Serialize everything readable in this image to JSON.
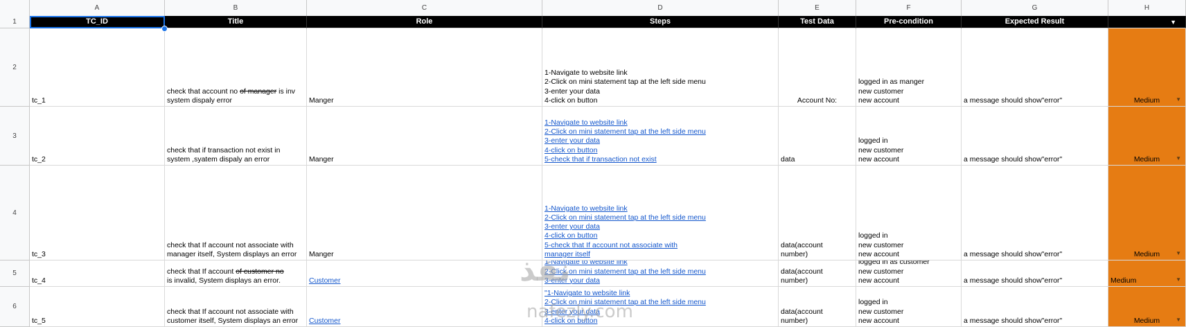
{
  "columns": [
    "A",
    "B",
    "C",
    "D",
    "E",
    "F",
    "G",
    "H"
  ],
  "row_numbers": [
    "1",
    "2",
    "3",
    "4",
    "5",
    "6"
  ],
  "headers": [
    "TC_ID",
    "Title",
    "Role",
    "Steps",
    "Test Data",
    "Pre-condition",
    "Expected Result",
    ""
  ],
  "rows": [
    {
      "id": "tc_1",
      "title_a": "check that account no ",
      "title_strike": "of  manager",
      "title_b": "  is inv\nsystem dispaly error",
      "role": "Manger",
      "steps": "1-Navigate to website link\n2-Click on  mini statement tap at the left side menu\n3-enter your data\n4-click on button",
      "test_data": "Account No:",
      "precondition": "logged in as manger\nnew customer\nnew account",
      "expected": "a message should show\"error\"",
      "priority": "Medium"
    },
    {
      "id": "tc_2",
      "title_a": "check that if transaction not exist in\nsystem ,syatem dispaly an error",
      "title_strike": "",
      "title_b": "",
      "role": "Manger",
      "steps": "1-Navigate to website link\n2-Click on  mini statement tap at the left side menu\n3-enter your data\n4-click on button\n5-check that if transaction not exist",
      "test_data": "data",
      "precondition": "logged in\nnew customer\nnew account",
      "expected": "a message should show\"error\"",
      "priority": "Medium"
    },
    {
      "id": "tc_3",
      "title_a": "check that If account not associate with\n manager itself, System displays an error",
      "title_strike": "",
      "title_b": "",
      "role": "Manger",
      "steps": "1-Navigate to website link\n2-Click on  mini statement tap at the left side menu\n3-enter your data\n4-click on button\n5-check that   If account not associate with\n manager itself",
      "test_data": "data(account\nnumber)",
      "precondition": "logged in\nnew customer\nnew account",
      "expected": "a message should show\"error\"",
      "priority": "Medium"
    },
    {
      "id": "tc_4",
      "title_a": "check that If account  ",
      "title_strike": "of  customer no",
      "title_b": "\n is invalid, System displays an error.",
      "role": "Customer",
      "steps": "1-Navigate to website link\n2-Click on  mini statement tap at the left side menu\n3-enter your data",
      "test_data": "data(account\nnumber)",
      "precondition": "logged in as customer\nnew customer\nnew account",
      "expected": "a message should show\"error\"",
      "priority": "Medium"
    },
    {
      "id": "tc_5",
      "title_a": "check that If account not associate with\n customer  itself, System displays an error",
      "title_strike": "",
      "title_b": "",
      "role": "Customer",
      "steps": "\"1-Navigate to website link\n2-Click on  mini statement tap at the left side menu\n3-enter your data\n4-click on button",
      "test_data": "data(account\nnumber)",
      "precondition": "logged in\nnew customer\nnew account",
      "expected": "a message should show\"error\"",
      "priority": "Medium"
    }
  ],
  "watermark": {
    "big": "نفذ",
    "small": "nafezly.com"
  },
  "icons": {
    "dropdown": "dropdown-arrow-icon"
  },
  "colors": {
    "header_bg": "#000000",
    "priority_bg": "#e67c13",
    "link": "#1155cc",
    "selection": "#1a73e8"
  }
}
